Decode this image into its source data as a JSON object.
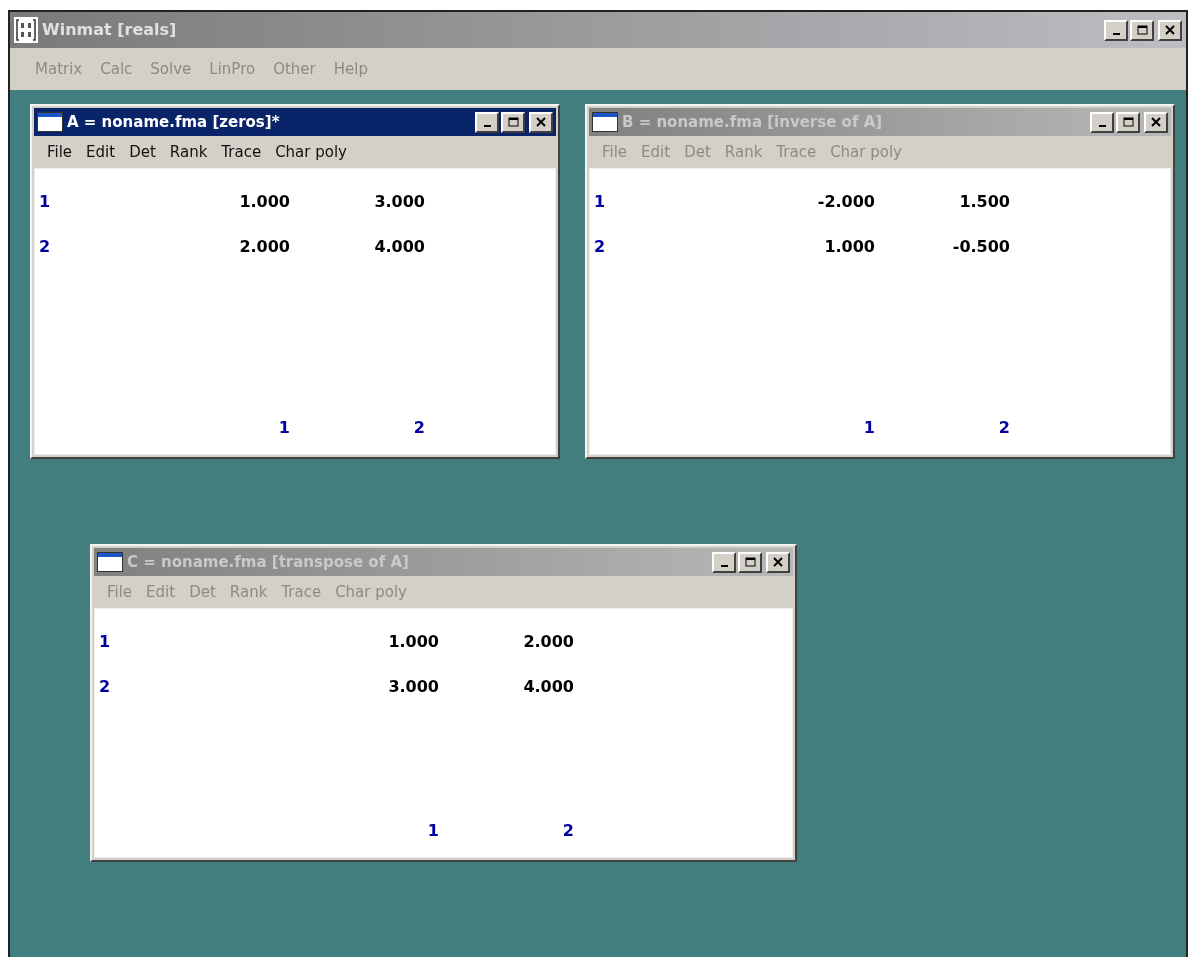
{
  "app": {
    "title": "Winmat [reals]",
    "active": false,
    "menu": [
      "Matrix",
      "Calc",
      "Solve",
      "LinPro",
      "Other",
      "Help"
    ]
  },
  "windows": [
    {
      "title": "A = noname.fma [zeros]*",
      "active": true,
      "menu": [
        "File",
        "Edit",
        "Det",
        "Rank",
        "Trace",
        "Char poly"
      ],
      "rows": [
        {
          "label": "1",
          "values": [
            "1.000",
            "3.000"
          ]
        },
        {
          "label": "2",
          "values": [
            "2.000",
            "4.000"
          ]
        }
      ],
      "column_labels": [
        "1",
        "2"
      ]
    },
    {
      "title": "B = noname.fma [inverse of A]",
      "active": false,
      "menu": [
        "File",
        "Edit",
        "Det",
        "Rank",
        "Trace",
        "Char poly"
      ],
      "rows": [
        {
          "label": "1",
          "values": [
            "-2.000",
            "1.500"
          ]
        },
        {
          "label": "2",
          "values": [
            "1.000",
            "-0.500"
          ]
        }
      ],
      "column_labels": [
        "1",
        "2"
      ]
    },
    {
      "title": "C = noname.fma [transpose of A]",
      "active": false,
      "menu": [
        "File",
        "Edit",
        "Det",
        "Rank",
        "Trace",
        "Char poly"
      ],
      "rows": [
        {
          "label": "1",
          "values": [
            "1.000",
            "2.000"
          ]
        },
        {
          "label": "2",
          "values": [
            "3.000",
            "4.000"
          ]
        }
      ],
      "column_labels": [
        "1",
        "2"
      ]
    }
  ]
}
